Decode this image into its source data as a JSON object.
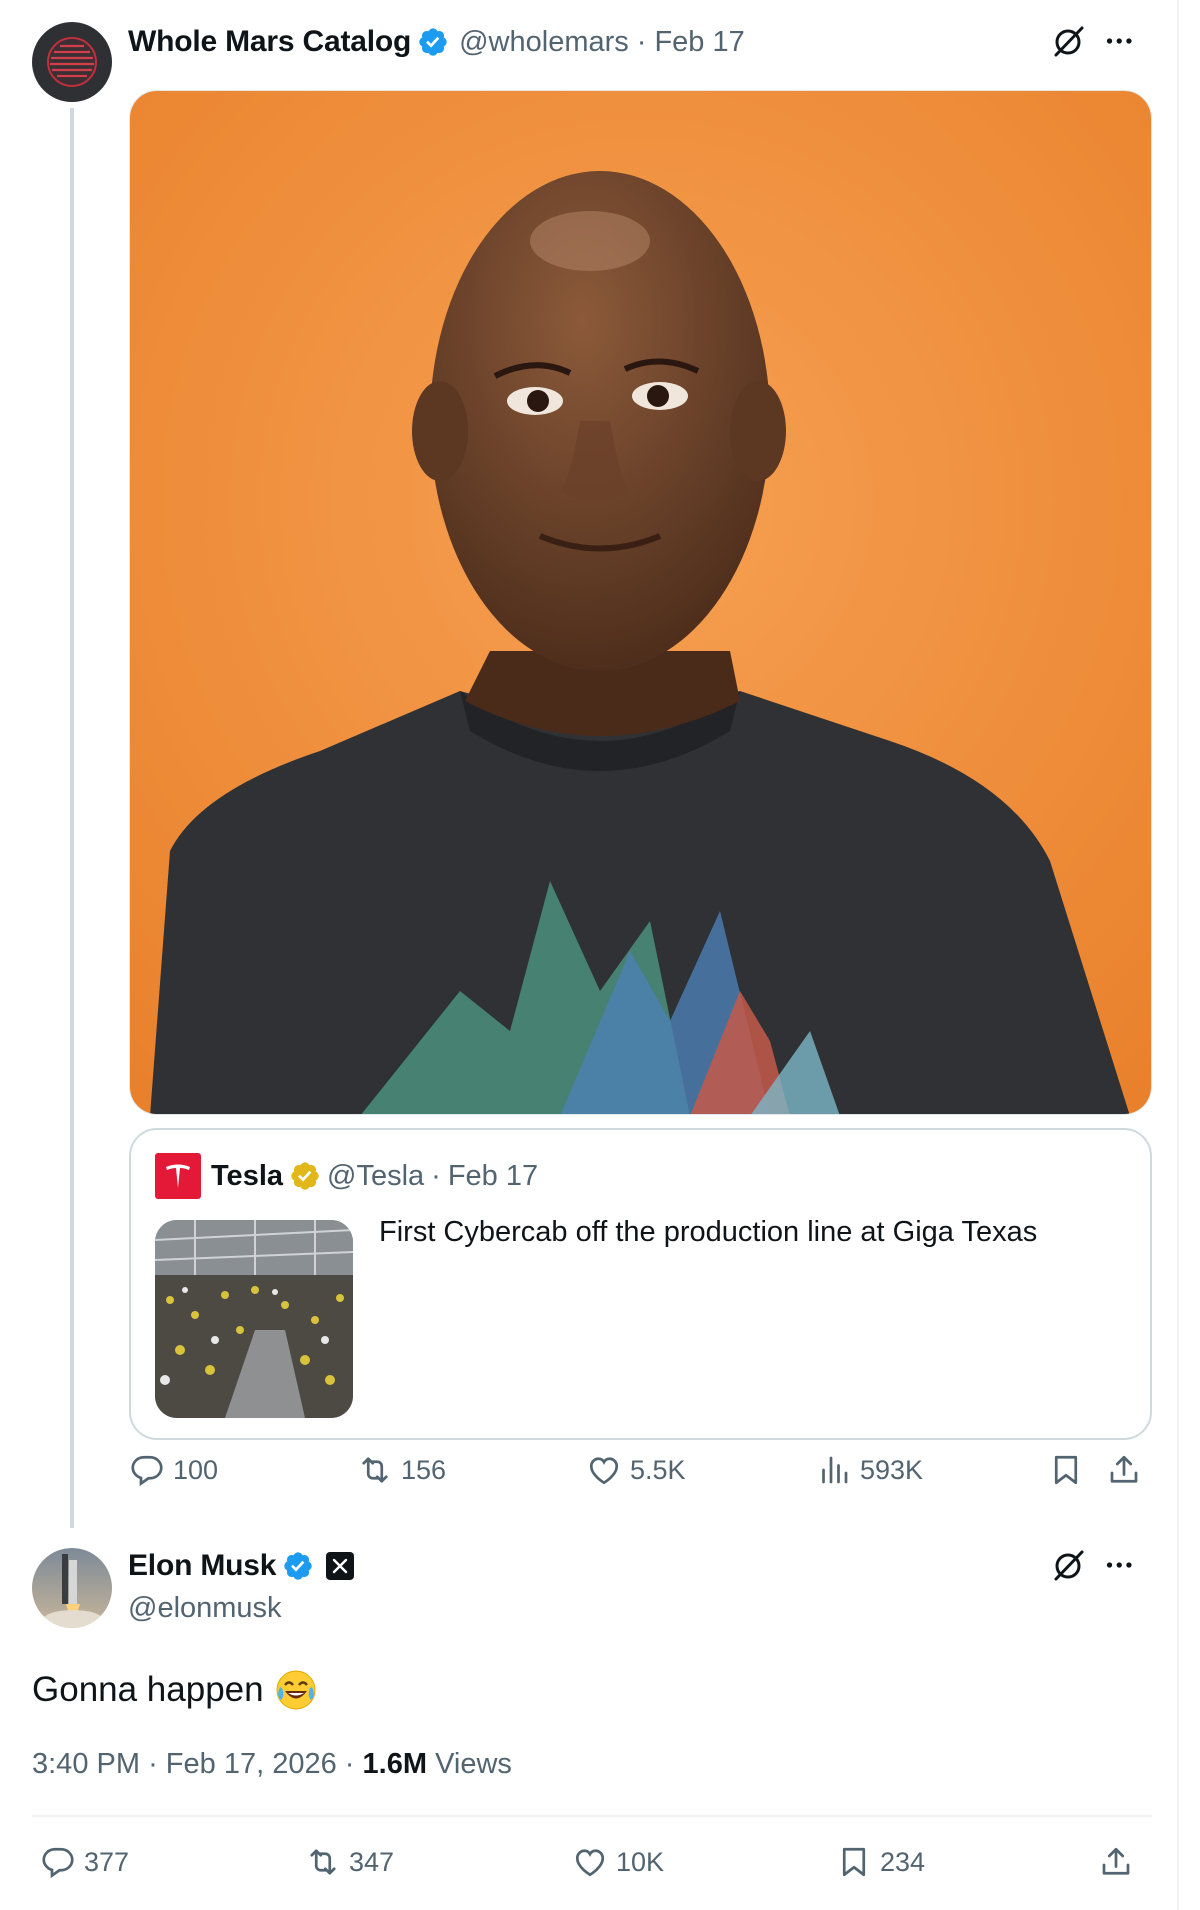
{
  "quoted_tweet_author": {
    "name": "Whole Mars Catalog",
    "handle": "@wholemars",
    "separator": "·",
    "date": "Feb 17"
  },
  "quote_card": {
    "name": "Tesla",
    "handle": "@Tesla",
    "separator": "·",
    "date": "Feb 17",
    "text": "First Cybercab off the production line at Giga Texas"
  },
  "first_actions": {
    "replies": "100",
    "reposts": "156",
    "likes": "5.5K",
    "views": "593K"
  },
  "reply_tweet": {
    "name": "Elon Musk",
    "handle": "@elonmusk",
    "text": "Gonna happen",
    "time": "3:40 PM",
    "separator": "·",
    "date": "Feb 17, 2026",
    "views_count": "1.6M",
    "views_label": "Views"
  },
  "second_actions": {
    "replies": "377",
    "reposts": "347",
    "likes": "10K",
    "bookmarks": "234"
  },
  "colors": {
    "verified_blue": "#1d9bf0",
    "verified_gold": "#e2b719",
    "muted_text": "#536471",
    "tesla_red": "#e31937",
    "photo_background": "#f0913c"
  },
  "icons": [
    "grok-icon",
    "more-icon",
    "reply-icon",
    "repost-icon",
    "like-icon",
    "views-icon",
    "bookmark-icon",
    "share-icon",
    "verified-badge-icon",
    "x-affiliate-icon",
    "laughing-emoji-icon"
  ]
}
